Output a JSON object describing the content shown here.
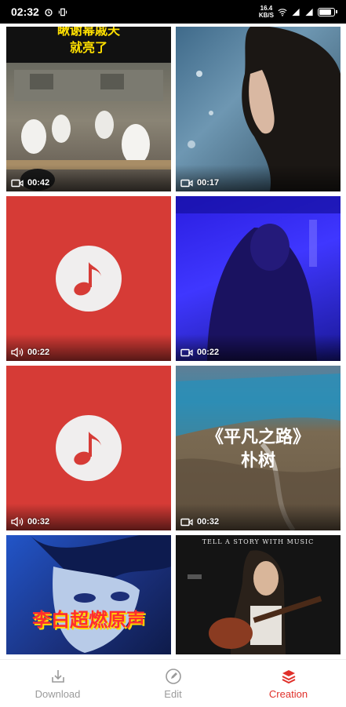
{
  "status_bar": {
    "time": "02:32",
    "network_top": "16.4",
    "network_bottom": "KB/S"
  },
  "tiles": [
    {
      "type": "video",
      "duration": "00:42",
      "caption": "瞅谢幂戚天\n就亮了"
    },
    {
      "type": "video",
      "duration": "00:17"
    },
    {
      "type": "audio",
      "duration": "00:22"
    },
    {
      "type": "video",
      "duration": "00:22"
    },
    {
      "type": "audio",
      "duration": "00:32"
    },
    {
      "type": "video",
      "duration": "00:32",
      "caption_line1": "《平凡之路》",
      "caption_line2": "朴树"
    },
    {
      "type": "video",
      "caption": "李白超燃原声"
    },
    {
      "type": "video",
      "caption": "TELL A STORY WITH MUSIC"
    }
  ],
  "bottom_nav": {
    "download_label": "Download",
    "edit_label": "Edit",
    "creation_label": "Creation"
  },
  "colors": {
    "accent": "#e0302a",
    "audio_tile": "#d63b36"
  }
}
